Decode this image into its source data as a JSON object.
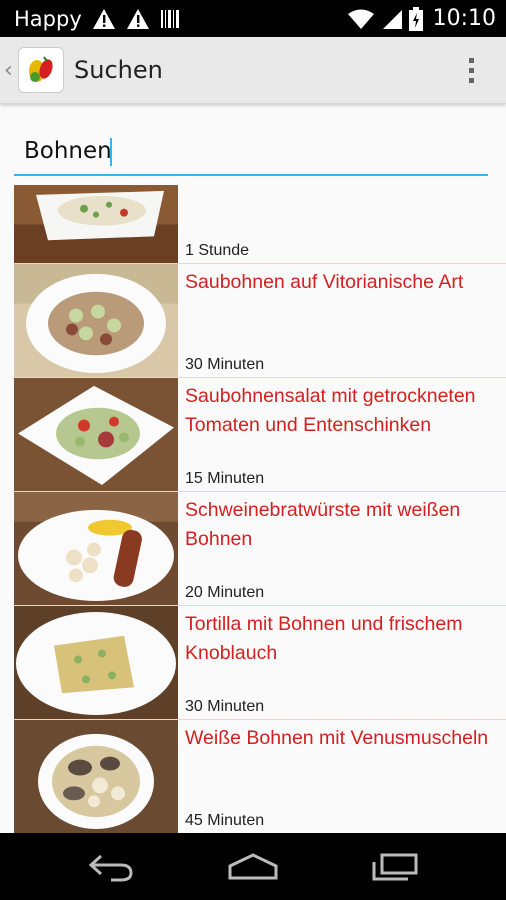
{
  "statusbar": {
    "carrier": "Happy",
    "time": "10:10"
  },
  "actionbar": {
    "title": "Suchen"
  },
  "search": {
    "value": "Bohnen"
  },
  "recipes": [
    {
      "name": "",
      "time": "1 Stunde"
    },
    {
      "name": "Saubohnen auf Vitorianische Art",
      "time": "30 Minuten"
    },
    {
      "name": "Saubohnensalat mit getrockneten Tomaten und Entenschinken",
      "time": "15 Minuten"
    },
    {
      "name": "Schweinebratwürste mit weißen Bohnen",
      "time": "20 Minuten"
    },
    {
      "name": "Tortilla mit Bohnen und frischem Knoblauch",
      "time": "30 Minuten"
    },
    {
      "name": "Weiße Bohnen mit Venusmuscheln",
      "time": "45 Minuten"
    }
  ],
  "colors": {
    "accent": "#33b5e5",
    "recipe_title": "#d42020",
    "divider": "#f1d7b8"
  },
  "icons": {
    "warning": "warning-icon",
    "wifi": "wifi-icon",
    "battery": "battery-icon",
    "back": "back-icon",
    "home": "home-icon",
    "recents": "recents-icon"
  }
}
